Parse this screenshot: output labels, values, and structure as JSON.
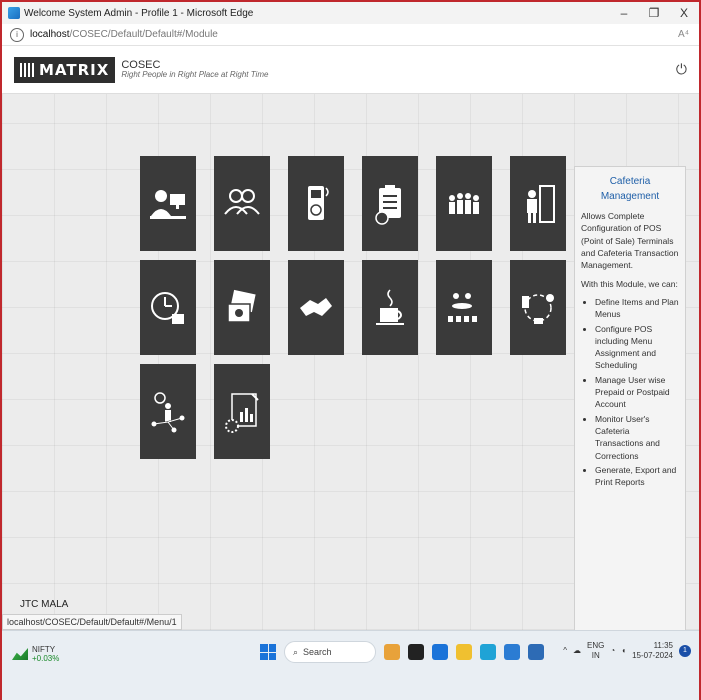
{
  "window": {
    "title": "Welcome System Admin - Profile 1 - Microsoft Edge",
    "minimize": "–",
    "restore": "❐",
    "close": "X"
  },
  "address": {
    "host": "localhost",
    "path": "/COSEC/Default/Default#/Module",
    "info_icon": "i",
    "read_icon": "A⁴"
  },
  "header": {
    "logo_text": "MATRIX",
    "product": "COSEC",
    "tagline": "Right People in Right Place at Right Time",
    "power_icon": "⏻"
  },
  "tiles": [
    {
      "name": "employee-management-tile",
      "icon": "user-desk-icon"
    },
    {
      "name": "user-groups-tile",
      "icon": "group-icon"
    },
    {
      "name": "access-device-tile",
      "icon": "fingerprint-device-icon"
    },
    {
      "name": "reports-tile",
      "icon": "clipboard-clock-icon"
    },
    {
      "name": "visitor-management-tile",
      "icon": "people-row-icon"
    },
    {
      "name": "door-access-tile",
      "icon": "person-door-icon"
    },
    {
      "name": "time-attendance-tile",
      "icon": "clock-calendar-icon"
    },
    {
      "name": "photo-gallery-tile",
      "icon": "photos-icon"
    },
    {
      "name": "handshake-tile",
      "icon": "handshake-icon"
    },
    {
      "name": "cafeteria-management-tile",
      "icon": "coffee-cup-icon"
    },
    {
      "name": "meeting-tile",
      "icon": "meeting-icon"
    },
    {
      "name": "payment-cycle-tile",
      "icon": "payment-cycle-icon"
    },
    {
      "name": "user-tracking-tile",
      "icon": "location-tracking-icon"
    },
    {
      "name": "report-settings-tile",
      "icon": "report-gear-icon"
    }
  ],
  "info_panel": {
    "title": "Cafeteria Management",
    "description": "Allows Complete Configuration of POS (Point of Sale) Terminals and Cafeteria Transaction Management.",
    "intro": "With this Module, we can:",
    "items": [
      "Define Items and Plan Menus",
      "Configure POS including Menu Assignment and Scheduling",
      "Manage User wise Prepaid or Postpaid Account",
      "Monitor User's Cafeteria Transactions and Corrections",
      "Generate, Export and Print Reports"
    ]
  },
  "site_label": "JTC MALA",
  "status_url": "localhost/COSEC/Default/Default#/Menu/1",
  "taskbar": {
    "nifty_name": "NIFTY",
    "nifty_value": "+0.03%",
    "search": "Search",
    "lang_top": "ENG",
    "lang_bottom": "IN",
    "time": "11:35",
    "date": "15-07-2024",
    "notifications": "1"
  },
  "colors": {
    "tile_bg": "#3a3a3a",
    "panel_title": "#1f5fa8",
    "window_border": "#c0282d"
  }
}
